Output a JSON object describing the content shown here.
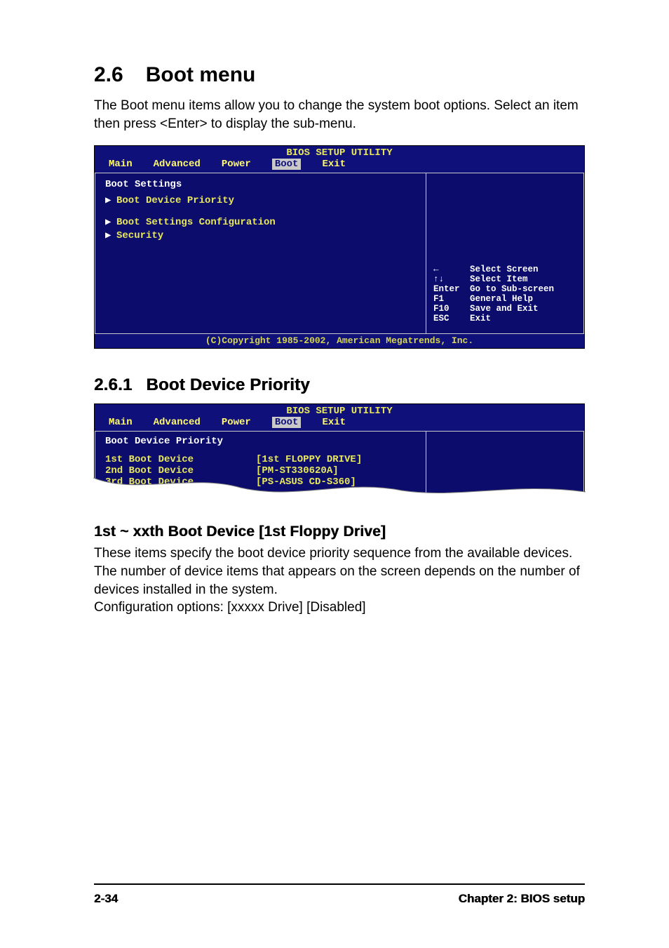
{
  "section": {
    "number": "2.6",
    "title": "Boot menu",
    "intro": "The Boot menu items allow you to change the system boot options. Select an item then press <Enter> to display the sub-menu."
  },
  "bios1": {
    "title": "BIOS SETUP UTILITY",
    "tabs": [
      "Main",
      "Advanced",
      "Power",
      "Boot",
      "Exit"
    ],
    "active_tab": "Boot",
    "heading": "Boot Settings",
    "items": [
      "Boot Device Priority",
      "Boot Settings Configuration",
      "Security"
    ],
    "legend": [
      {
        "key": "←",
        "desc": "Select Screen"
      },
      {
        "key": "↑↓",
        "desc": "Select Item"
      },
      {
        "key": "Enter",
        "desc": "Go to Sub-screen"
      },
      {
        "key": "F1",
        "desc": "General Help"
      },
      {
        "key": "F10",
        "desc": "Save and Exit"
      },
      {
        "key": "ESC",
        "desc": "Exit"
      }
    ],
    "copyright": "(C)Copyright 1985-2002, American Megatrends, Inc."
  },
  "subsection": {
    "number": "2.6.1",
    "title": "Boot Device Priority"
  },
  "bios2": {
    "title": "BIOS SETUP UTILITY",
    "tabs": [
      "Main",
      "Advanced",
      "Power",
      "Boot",
      "Exit"
    ],
    "active_tab": "Boot",
    "heading": "Boot Device Priority",
    "rows": [
      {
        "label": "1st Boot Device",
        "value": "[1st FLOPPY DRIVE]"
      },
      {
        "label": "2nd Boot Device",
        "value": "[PM-ST330620A]"
      },
      {
        "label": "3rd Boot Device",
        "value": "[PS-ASUS CD-S360]"
      }
    ]
  },
  "item": {
    "title": "1st ~ xxth Boot Device [1st Floppy Drive]",
    "body": "These items specify the boot device priority sequence from the available devices. The number of device items that appears on the screen depends on the number of devices installed in the system.",
    "config": "Configuration options: [xxxxx Drive] [Disabled]"
  },
  "footer": {
    "page": "2-34",
    "chapter": "Chapter 2: BIOS setup"
  }
}
